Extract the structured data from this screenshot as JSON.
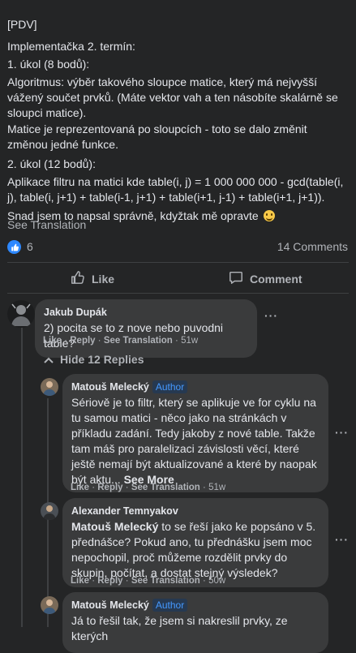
{
  "post": {
    "tag": "[PDV]",
    "line1": "Implementačka 2. termín:",
    "line2": "1. úkol (8 bodů):",
    "para3": "Algoritmus: výběr takového sloupce matice, který má nejvyšší vážený součet prvků. (Máte vektor vah a ten násobíte skalárně se sloupci matice).",
    "para4": "Matice je reprezentovaná po sloupcích - toto se dalo změnit změnou jedné funkce.",
    "line5": "2. úkol (12 bodů):",
    "para6": "Aplikace filtru na matici kde table(i, j) = 1 000 000 000 - gcd(table(i, j), table(i, j+1) + table(i-1, j+1) + table(i+1, j-1) + table(i+1, j+1)).",
    "line7": "Snad jsem to napsal správně, kdyžtak mě opravte",
    "see_translation": "See Translation"
  },
  "stats": {
    "likes": "6",
    "comments": "14 Comments"
  },
  "actions": {
    "like": "Like",
    "comment": "Comment"
  },
  "comments": [
    {
      "name": "Jakub Dupák",
      "text": "2) pocita se to z nove nebo puvodni table?",
      "meta_like": "Like",
      "meta_reply": "Reply",
      "meta_translate": "See Translation",
      "meta_time": "51w"
    }
  ],
  "hide_replies": "Hide 12 Replies",
  "replies": [
    {
      "name": "Matouš Melecký",
      "badge": "Author",
      "text": "Sériově je to filtr, který se aplikuje ve for cyklu na tu samou matici - něco jako na stránkách v příkladu zadání. Tedy jakoby z nové table. Takže tam máš pro paralelizaci závislosti věcí, které ještě nemají být aktualizované a které by naopak být aktu...",
      "see_more": "See More",
      "meta_like": "Like",
      "meta_reply": "Reply",
      "meta_translate": "See Translation",
      "meta_time": "51w"
    },
    {
      "name": "Alexander Temnyakov",
      "mention": "Matouš Melecký",
      "text": "to se řeší jako ke popsáno v 5. přednášce? Pokud ano, tu přednášku jsem moc nepochopil, proč můžeme rozdělit prvky do skupin, počítat, a dostat stejný výsledek?",
      "meta_like": "Like",
      "meta_reply": "Reply",
      "meta_translate": "See Translation",
      "meta_time": "50w"
    },
    {
      "name": "Matouš Melecký",
      "badge": "Author",
      "text": "Já to řešil tak, že jsem si nakreslil prvky, ze kterých"
    }
  ],
  "colors": {
    "background": "#242526",
    "bubble": "#3a3b3c",
    "accent": "#2d88ff",
    "muted": "#b0b3b8"
  }
}
